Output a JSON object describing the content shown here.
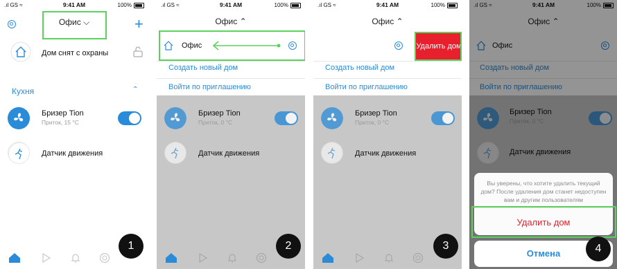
{
  "status_bar": {
    "carrier": "GS",
    "time": "9:41 AM",
    "battery": "100%"
  },
  "home": {
    "title": "Офис",
    "security_status": "Дом снят с охраны"
  },
  "room": {
    "name": "Кухня"
  },
  "devices": [
    {
      "name": "Бризер Tion",
      "subtitle_on": "Приток, 15 °C",
      "subtitle_dim": "Приток, 0 °C",
      "enabled": true
    },
    {
      "name": "Датчик движения"
    }
  ],
  "home_list": {
    "current": "Офис",
    "create_new": "Создать новый дом",
    "join_invite": "Войти по приглашению"
  },
  "delete": {
    "button_label": "Удалить дом",
    "confirm_message": "Вы уверены, что хотите удалить текущий дом? После удаления дом станет недоступен вам и другим пользователям",
    "confirm_action": "Удалить дом",
    "cancel": "Отмена"
  },
  "steps": [
    "1",
    "2",
    "3",
    "4"
  ],
  "colors": {
    "accent": "#2a8bd8",
    "danger": "#e8202e",
    "highlight": "#5cd15c"
  },
  "tabs": [
    "home-icon",
    "play-icon",
    "bell-icon",
    "sensor-icon",
    "profile-icon"
  ]
}
